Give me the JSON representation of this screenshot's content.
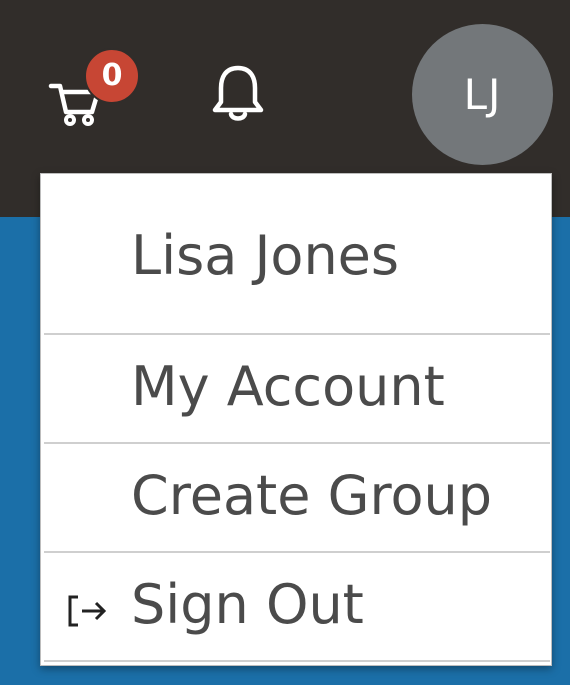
{
  "header": {
    "cart": {
      "icon": "cart-icon",
      "count": "0"
    },
    "notifications": {
      "icon": "bell-icon"
    },
    "avatar": {
      "initials": "LJ"
    }
  },
  "menu": {
    "user_name": "Lisa Jones",
    "items": [
      {
        "label": "My Account"
      },
      {
        "label": "Create Group"
      },
      {
        "label": "Sign Out",
        "icon": "sign-out-icon"
      }
    ]
  },
  "colors": {
    "header_bg": "#312d2a",
    "page_bg": "#1b6fa8",
    "badge": "#c74634",
    "avatar_bg": "#73777a",
    "menu_text": "#4b4b4b"
  }
}
